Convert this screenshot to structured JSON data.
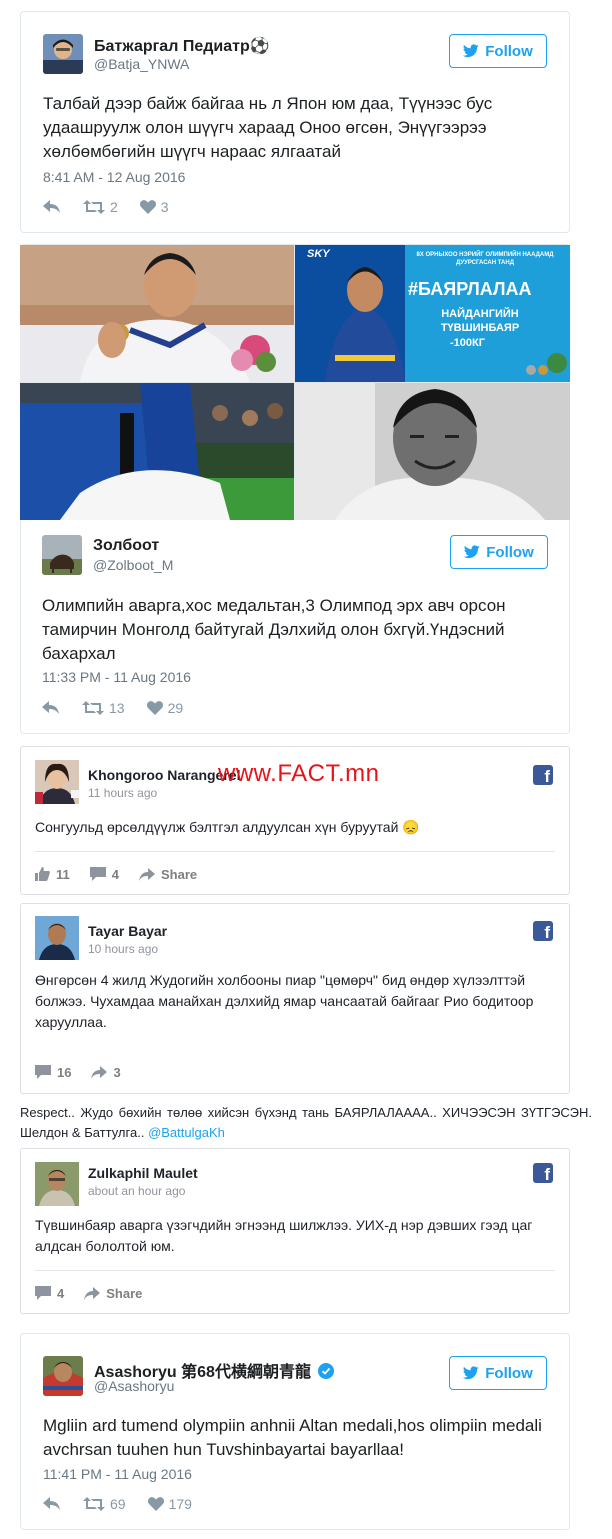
{
  "tweets": [
    {
      "name": "Батжаргал Педиатр⚽",
      "handle": "@Batja_YNWA",
      "follow_label": "Follow",
      "text": "Талбай дээр байж байгаа нь л Япон юм даа, Түүнээс бус удаашруулж олон шүүгч хараад Оноо өгсөн, Энүүгээрээ хөлбөмбөгийн шүүгч нараас ялгаатай",
      "date": "8:41 AM - 12 Aug 2016",
      "retweets": "2",
      "likes": "3"
    },
    {
      "name": "Золбоот",
      "handle": "@Zolboot_M",
      "follow_label": "Follow",
      "text": "Олимпийн аварга,хос медальтан,3 Олимпод эрх авч орсон тамирчин Монголд байтугай Дэлхийд олон бхгүй.Үндэсний бахархал",
      "date": "11:33 PM - 11 Aug 2016",
      "retweets": "13",
      "likes": "29"
    },
    {
      "name": "Asashoryu 第68代横綱朝青龍",
      "handle": "@Asashoryu",
      "follow_label": "Follow",
      "text": "Mgliin ard tumend olympiin anhnii Altan medali,hos olimpiin medali avchrsan tuuhen hun Tuvshinbayartai bayarllaa!",
      "date": "11:41 PM - 11 Aug 2016",
      "retweets": "69",
      "likes": "179"
    }
  ],
  "photo_banner": {
    "brand": "SKY",
    "top_line": "8Х ОРНЫХОО НЭРИЙГ ОЛИМПИЙН НААДАМД ДУУРСГАСАН ТАНД",
    "hashtag": "#БАЯРЛАЛАА",
    "athlete": "НАЙДАНГИЙН ТҮВШИНБАЯР",
    "weight": "-100КГ"
  },
  "fb_posts": [
    {
      "name": "Khongoroo Narangerel",
      "time": "11 hours ago",
      "text": "Сонгуульд өрсөлдүүлж бэлтгэл алдуулсан хүн буруутай 😞",
      "likes": "11",
      "comments": "4",
      "share_label": "Share"
    },
    {
      "name": "Tayar Bayar",
      "time": "10 hours ago",
      "text": "Өнгөрсөн 4 жилд Жудогийн холбооны пиар \"цөмөрч\" бид өндөр хүлээлттэй болжээ. Чухамдаа манайхан дэлхийд ямар чансаатай байгааг Рио бодитоор харууллаа.",
      "comments": "16",
      "shares": "3"
    },
    {
      "name": "Zulkaphil Maulet",
      "time": "about an hour ago",
      "text": "Түвшинбаяр аварга үзэгчдийн эгнээнд шилжлээ. УИХ-д нэр дэвших гээд цаг алдсан бололтой юм.",
      "comments": "4",
      "share_label": "Share"
    }
  ],
  "plain_post": {
    "text": "Respect.. Жудо бөхийн төлөө хийсэн бүхэнд тань БАЯРЛАЛАААА.. ХИЧЭЭСЭН ЗҮТГЭСЭН. Шелдон & Баттулга..",
    "mention": "@BattulgaKh"
  },
  "watermark": "www.FACT.mn",
  "colors": {
    "twitter_blue": "#1da1f2",
    "facebook_blue": "#3b5998",
    "watermark_red": "#e8131a"
  }
}
